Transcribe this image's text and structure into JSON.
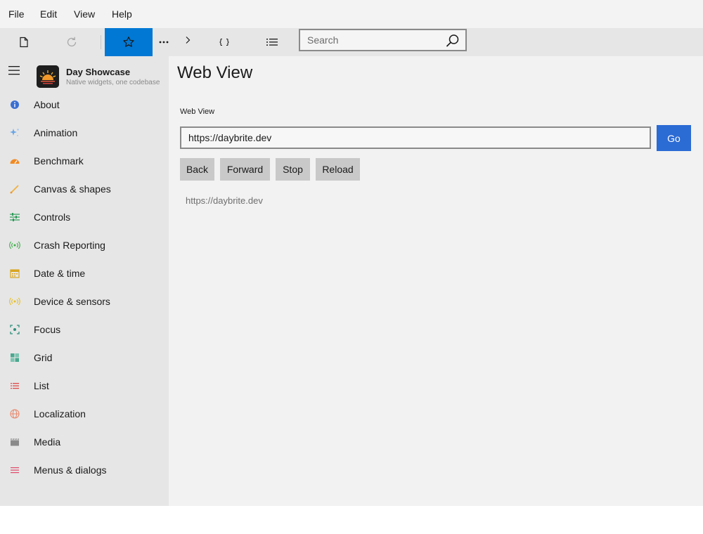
{
  "menubar": {
    "items": [
      "File",
      "Edit",
      "View",
      "Help"
    ]
  },
  "toolbar": {
    "buttons": [
      {
        "icon": "document-icon"
      },
      {
        "icon": "refresh-icon"
      },
      {
        "icon": "star-icon"
      },
      {
        "icon": "ellipsis-icon"
      },
      {
        "icon": "chevron-right-icon"
      },
      {
        "icon": "braces-icon"
      },
      {
        "icon": "list-icon"
      }
    ],
    "active_color": "#0078d4"
  },
  "search": {
    "placeholder": "Search",
    "value": ""
  },
  "sidebar": {
    "app_title": "Day Showcase",
    "app_subtitle": "Native widgets, one codebase",
    "items": [
      {
        "label": "About",
        "icon": "info-icon",
        "color": "#3b6fd1"
      },
      {
        "label": "Animation",
        "icon": "sparkle-icon",
        "color": "#6aa6e6"
      },
      {
        "label": "Benchmark",
        "icon": "speedometer-icon",
        "color": "#f08a24"
      },
      {
        "label": "Canvas & shapes",
        "icon": "brush-icon",
        "color": "#f0b040"
      },
      {
        "label": "Controls",
        "icon": "sliders-icon",
        "color": "#2e9c5a"
      },
      {
        "label": "Crash Reporting",
        "icon": "broadcast-icon",
        "color": "#3fae4c"
      },
      {
        "label": "Date & time",
        "icon": "calendar-icon",
        "color": "#d9a520"
      },
      {
        "label": "Device & sensors",
        "icon": "sensor-icon",
        "color": "#e6c02a"
      },
      {
        "label": "Focus",
        "icon": "focus-icon",
        "color": "#2e8f7a"
      },
      {
        "label": "Grid",
        "icon": "grid-icon",
        "color": "#4aa88f"
      },
      {
        "label": "List",
        "icon": "list-icon",
        "color": "#e04848"
      },
      {
        "label": "Localization",
        "icon": "globe-icon",
        "color": "#e8866a"
      },
      {
        "label": "Media",
        "icon": "clapperboard-icon",
        "color": "#8a8a8a"
      },
      {
        "label": "Menus & dialogs",
        "icon": "menu-lines-icon",
        "color": "#e04a6a"
      }
    ]
  },
  "main": {
    "title": "Web View",
    "section_label": "Web View",
    "url_value": "https://daybrite.dev",
    "go_label": "Go",
    "go_color": "#2b6bd4",
    "buttons": {
      "back": "Back",
      "forward": "Forward",
      "stop": "Stop",
      "reload": "Reload"
    },
    "current_url": "https://daybrite.dev"
  }
}
